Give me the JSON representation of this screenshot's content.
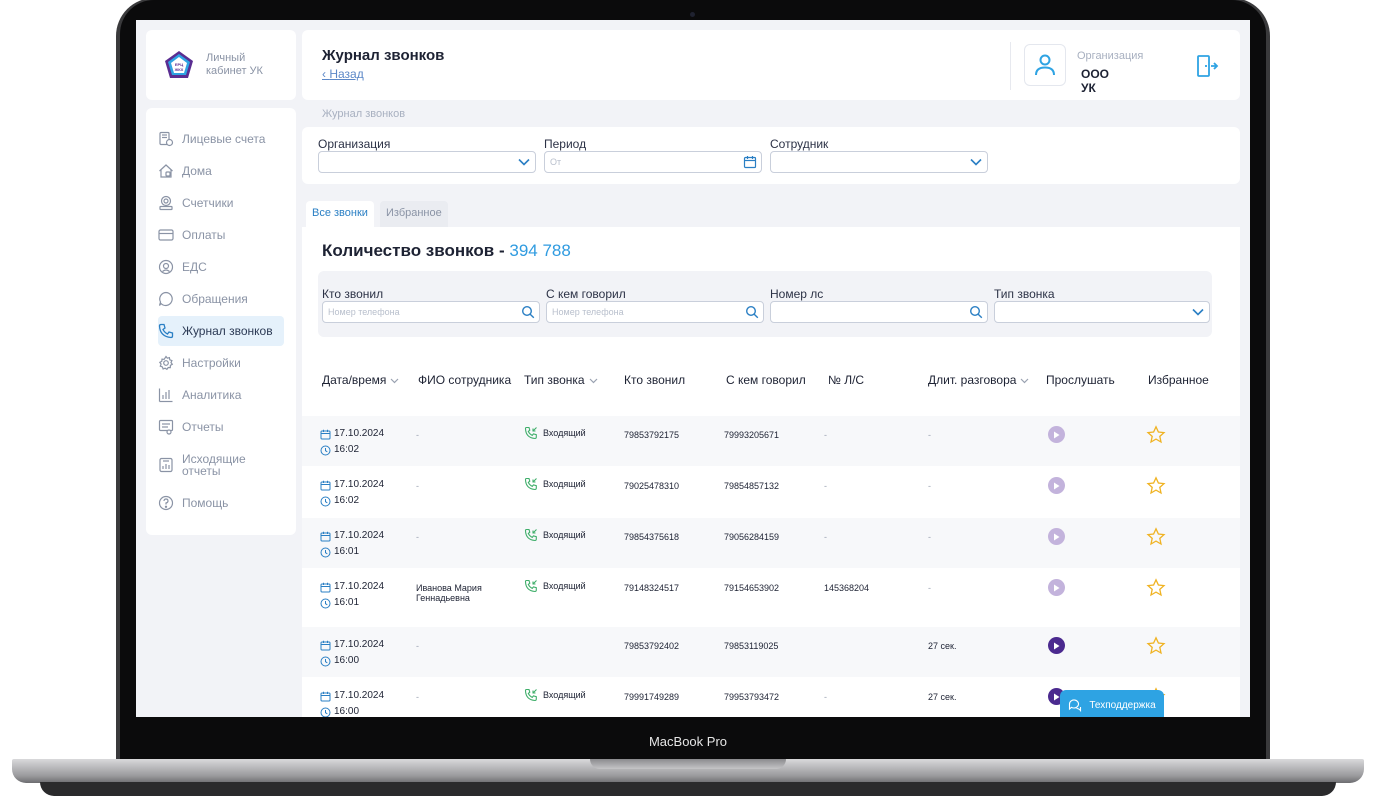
{
  "device": {
    "label": "MacBook Pro"
  },
  "logo": {
    "badge": "ЕРЦ ЖКХ",
    "text": "Личный кабинет УК"
  },
  "sidebar": {
    "items": [
      {
        "label": "Лицевые счета",
        "icon": "accounts-icon",
        "active": false
      },
      {
        "label": "Дома",
        "icon": "house-icon",
        "active": false
      },
      {
        "label": "Счетчики",
        "icon": "meter-icon",
        "active": false
      },
      {
        "label": "Оплаты",
        "icon": "card-icon",
        "active": false
      },
      {
        "label": "ЕДС",
        "icon": "dispatch-icon",
        "active": false
      },
      {
        "label": "Обращения",
        "icon": "chat-icon",
        "active": false
      },
      {
        "label": "Журнал звонков",
        "icon": "phone-icon",
        "active": true
      },
      {
        "label": "Настройки",
        "icon": "gear-icon",
        "active": false
      },
      {
        "label": "Аналитика",
        "icon": "bar-chart-icon",
        "active": false
      },
      {
        "label": "Отчеты",
        "icon": "report-icon",
        "active": false
      },
      {
        "label": "Исходящие отчеты",
        "icon": "outgoing-report-icon",
        "active": false
      },
      {
        "label": "Помощь",
        "icon": "help-icon",
        "active": false
      }
    ]
  },
  "header": {
    "title": "Журнал звонков",
    "back": "Назад",
    "org_label": "Организация",
    "org_value": "ООО УК"
  },
  "breadcrumb": "Журнал звонков",
  "filters": {
    "organization_label": "Организация",
    "period_label": "Период",
    "period_placeholder": "От",
    "employee_label": "Сотрудник"
  },
  "tabs": [
    {
      "label": "Все звонки",
      "active": true
    },
    {
      "label": "Избранное",
      "active": false
    }
  ],
  "summary": {
    "label": "Количество звонков - ",
    "value": "394 788"
  },
  "search": {
    "caller_label": "Кто звонил",
    "caller_placeholder": "Номер телефона",
    "callee_label": "С кем говорил",
    "callee_placeholder": "Номер телефона",
    "account_label": "Номер лс",
    "type_label": "Тип звонка"
  },
  "table": {
    "columns": [
      "Дата/время",
      "ФИО сотрудника",
      "Тип звонка",
      "Кто звонил",
      "С кем говорил",
      "№ Л/С",
      "Длит. разговора",
      "Прослушать",
      "Избранное"
    ],
    "rows": [
      {
        "date": "17.10.2024",
        "time": "16:02",
        "employee": "-",
        "type": "Входящий",
        "caller": "79853792175",
        "callee": "79993205671",
        "account": "-",
        "duration": "-",
        "playable": false
      },
      {
        "date": "17.10.2024",
        "time": "16:02",
        "employee": "-",
        "type": "Входящий",
        "caller": "79025478310",
        "callee": "79854857132",
        "account": "-",
        "duration": "-",
        "playable": false
      },
      {
        "date": "17.10.2024",
        "time": "16:01",
        "employee": "-",
        "type": "Входящий",
        "caller": "79854375618",
        "callee": "79056284159",
        "account": "-",
        "duration": "-",
        "playable": false
      },
      {
        "date": "17.10.2024",
        "time": "16:01",
        "employee": "Иванова Мария Геннадьевна",
        "type": "Входящий",
        "caller": "79148324517",
        "callee": "79154653902",
        "account": "145368204",
        "duration": "-",
        "playable": false
      },
      {
        "date": "17.10.2024",
        "time": "16:00",
        "employee": "-",
        "type": "",
        "caller": "79853792402",
        "callee": "79853119025",
        "account": "",
        "duration": "27 сек.",
        "playable": true
      },
      {
        "date": "17.10.2024",
        "time": "16:00",
        "employee": "-",
        "type": "Входящий",
        "caller": "79991749289",
        "callee": "79953793472",
        "account": "-",
        "duration": "27 сек.",
        "playable": true
      }
    ]
  },
  "support": {
    "label": "Техподдержка"
  },
  "colors": {
    "accent": "#2f9be0",
    "play_active": "#4b2a8f",
    "play_inactive": "#c3b3dc",
    "star": "#f0b323",
    "call_icon": "#3fae6a"
  }
}
